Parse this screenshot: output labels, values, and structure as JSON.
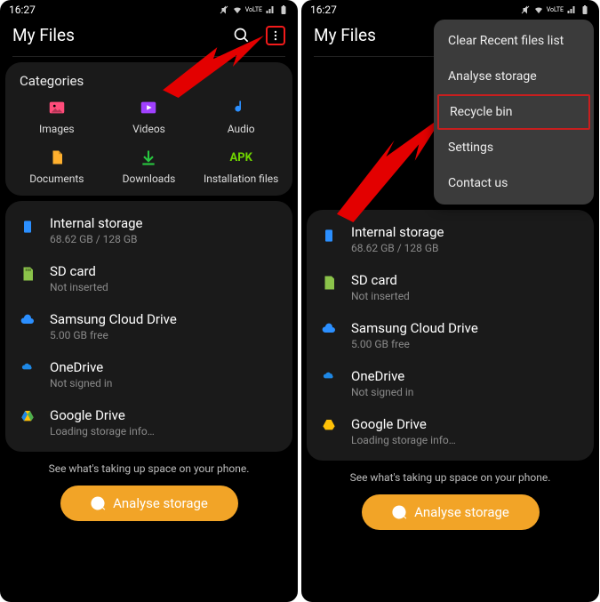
{
  "status": {
    "time": "16:27"
  },
  "appbar": {
    "title": "My Files"
  },
  "categories": {
    "title": "Categories",
    "items": [
      {
        "label": "Images"
      },
      {
        "label": "Videos"
      },
      {
        "label": "Audio"
      },
      {
        "label": "Documents"
      },
      {
        "label": "Downloads"
      },
      {
        "label": "Installation files"
      }
    ]
  },
  "storage": [
    {
      "title": "Internal storage",
      "sub": "68.62 GB / 128 GB"
    },
    {
      "title": "SD card",
      "sub": "Not inserted"
    },
    {
      "title": "Samsung Cloud Drive",
      "sub": "5.00 GB free"
    },
    {
      "title": "OneDrive",
      "sub": "Not signed in"
    },
    {
      "title": "Google Drive",
      "sub": "Loading storage info…"
    }
  ],
  "footer": {
    "hint": "See what's taking up space on your phone.",
    "button": "Analyse storage"
  },
  "menu": {
    "items": [
      {
        "label": "Clear Recent files list"
      },
      {
        "label": "Analyse storage"
      },
      {
        "label": "Recycle bin"
      },
      {
        "label": "Settings"
      },
      {
        "label": "Contact us"
      }
    ]
  }
}
